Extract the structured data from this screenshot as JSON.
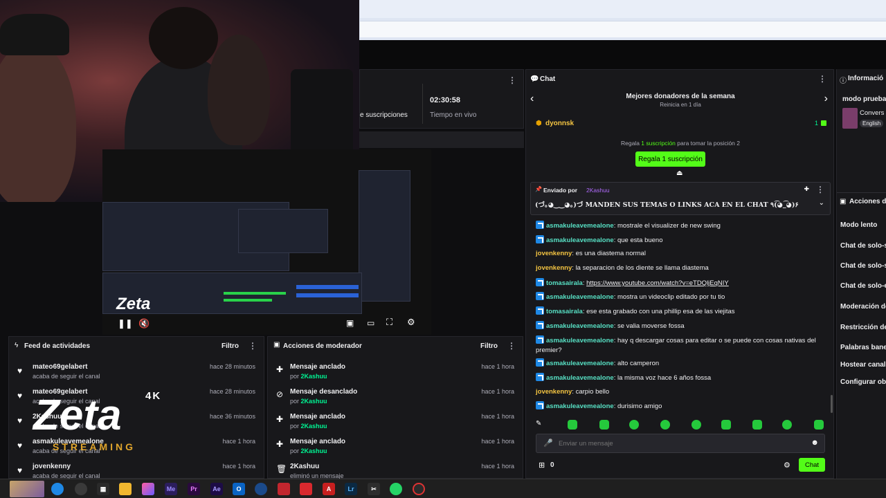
{
  "stats": {
    "subs_label": "e suscripciones",
    "live_time": "02:30:58",
    "live_label": "Tiempo en vivo"
  },
  "watermark": {
    "brand": "Zeta",
    "sub": "STREAMING",
    "res": "4K"
  },
  "feed": {
    "title": "Feed de actividades",
    "filter": "Filtro",
    "items": [
      {
        "name": "mateo69gelabert",
        "sub": "acaba de seguir el canal",
        "time": "hace 28 minutos"
      },
      {
        "name": "mateo69gelabert",
        "sub": "acaba de seguir el canal",
        "time": "hace 28 minutos"
      },
      {
        "name": "2Kashuu",
        "sub": "acaba de seguir el canal",
        "time": "hace 36 minutos"
      },
      {
        "name": "asmakuleavemealone",
        "sub": "acaba de seguir el canal",
        "time": "hace 1 hora"
      },
      {
        "name": "jovenkenny",
        "sub": "acaba de seguir el canal",
        "time": "hace 1 hora"
      }
    ]
  },
  "mod": {
    "title": "Acciones de moderador",
    "filter": "Filtro",
    "by_prefix": "por",
    "items": [
      {
        "title": "Mensaje anclado",
        "by": "2Kashuu",
        "time": "hace 1 hora",
        "icon": "pin-icon"
      },
      {
        "title": "Mensaje desanclado",
        "by": "2Kashuu",
        "time": "hace 1 hora",
        "icon": "unpin-icon"
      },
      {
        "title": "Mensaje anclado",
        "by": "2Kashuu",
        "time": "hace 1 hora",
        "icon": "pin-icon"
      },
      {
        "title": "Mensaje anclado",
        "by": "2Kashuu",
        "time": "hace 1 hora",
        "icon": "pin-icon"
      },
      {
        "title": "2Kashuu",
        "by": "eliminó un mensaje",
        "time": "hace 1 hora",
        "icon": "trash-icon"
      }
    ]
  },
  "chat": {
    "title": "Chat",
    "leader_title": "Mejores donadores de la semana",
    "leader_sub": "Reinicia en 1 día",
    "top_user": "dyonnsk",
    "top_count": "1",
    "gift_prompt_pre": "Regala",
    "gift_prompt_link": "1 suscripción",
    "gift_prompt_post": "para tomar la posición 2",
    "gift_button": "Regala 1 suscripción",
    "pinned_by_label": "Enviado por",
    "pinned_by_user": "2Kashuu",
    "pinned_text": "(づ｡◕‿‿◕｡)づ MANDEN SUS TEMAS O LINKS ACA EN EL CHAT ٩(͡◕_͡◕)۶",
    "messages": [
      {
        "user": "asmakuleavemealone",
        "text": "mostrale el visualizer de new swing",
        "badge": true,
        "color": "teal"
      },
      {
        "user": "asmakuleavemealone",
        "text": "que esta bueno",
        "badge": true,
        "color": "teal"
      },
      {
        "user": "jovenkenny",
        "text": "es una diastema normal",
        "badge": false,
        "color": "yellow"
      },
      {
        "user": "jovenkenny",
        "text": "la separacion de los diente se llama diastema",
        "badge": false,
        "color": "yellow"
      },
      {
        "user": "tomasairala",
        "text": "https://www.youtube.com/watch?v=eTDQljEqNIY",
        "badge": true,
        "color": "teal",
        "link": true
      },
      {
        "user": "asmakuleavemealone",
        "text": "mostra un videoclip editado por tu tio",
        "badge": true,
        "color": "teal"
      },
      {
        "user": "tomasairala",
        "text": "ese esta grabado con una phillip esa de las viejitas",
        "badge": true,
        "color": "teal"
      },
      {
        "user": "asmakuleavemealone",
        "text": "se valia moverse fossa",
        "badge": true,
        "color": "teal"
      },
      {
        "user": "asmakuleavemealone",
        "text": "hay q descargar cosas para editar o se puede con cosas nativas del premier?",
        "badge": true,
        "color": "teal"
      },
      {
        "user": "asmakuleavemealone",
        "text": "alto camperon",
        "badge": true,
        "color": "teal"
      },
      {
        "user": "asmakuleavemealone",
        "text": "la misma voz hace 6 años fossa",
        "badge": true,
        "color": "teal"
      },
      {
        "user": "jovenkenny",
        "text": "carpio bello",
        "badge": false,
        "color": "yellow"
      },
      {
        "user": "asmakuleavemealone",
        "text": "durisimo amigo",
        "badge": true,
        "color": "teal"
      }
    ],
    "input_placeholder": "Enviar un mensaje",
    "points": "0",
    "send_label": "Chat"
  },
  "right": {
    "title": "Informació",
    "stream_name": "modo prueba",
    "category": "Convers",
    "lang": "English",
    "actions_title": "Acciones de",
    "actions": [
      "Modo lento",
      "Chat de solo-so",
      "Chat de solo-s",
      "Chat de solo-e",
      "Moderación de",
      "Restricción de",
      "Palabras banea",
      "Hostear canal",
      "Configurar obj"
    ]
  },
  "taskbar": {
    "apps": [
      "Me",
      "Pr",
      "Ae",
      "Lr"
    ]
  },
  "colors": {
    "kick_green": "#53fc18",
    "panel": "#18181b"
  }
}
